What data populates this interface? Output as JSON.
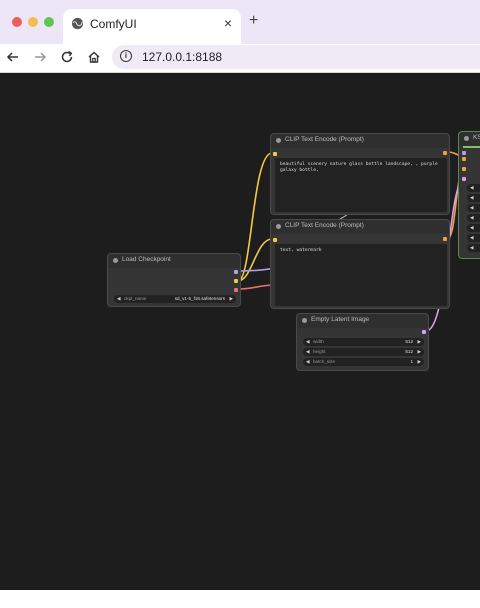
{
  "browser": {
    "tab_title": "ComfyUI",
    "tab_close": "×",
    "new_tab": "+",
    "url": "127.0.0.1:8188"
  },
  "nodes": {
    "clip_positive": {
      "title": "CLIP Text Encode (Prompt)",
      "text": "beautiful scenery nature glass bottle landscape, , purple galaxy bottle,"
    },
    "clip_negative": {
      "title": "CLIP Text Encode (Prompt)",
      "text": "text, watermark"
    },
    "load_checkpoint": {
      "title": "Load Checkpoint",
      "ckpt_name_label": "ckpt_name",
      "ckpt_name_value": "sd_v1-5_f16.safetensors"
    },
    "empty_latent": {
      "title": "Empty Latent Image",
      "widgets": [
        {
          "label": "width",
          "value": "512"
        },
        {
          "label": "height",
          "value": "512"
        },
        {
          "label": "batch_size",
          "value": "1"
        }
      ]
    },
    "ksampler": {
      "title": "KS"
    }
  },
  "colors": {
    "canvas_bg": "#1d1d1d",
    "node_bg": "#353535",
    "wire_model": "#b39ddb",
    "wire_clip": "#f5c842",
    "wire_vae": "#e57373",
    "wire_conditioning": "#f0a040",
    "wire_latent": "#d8a0e8",
    "ksampler_border": "#5a8a4a"
  }
}
